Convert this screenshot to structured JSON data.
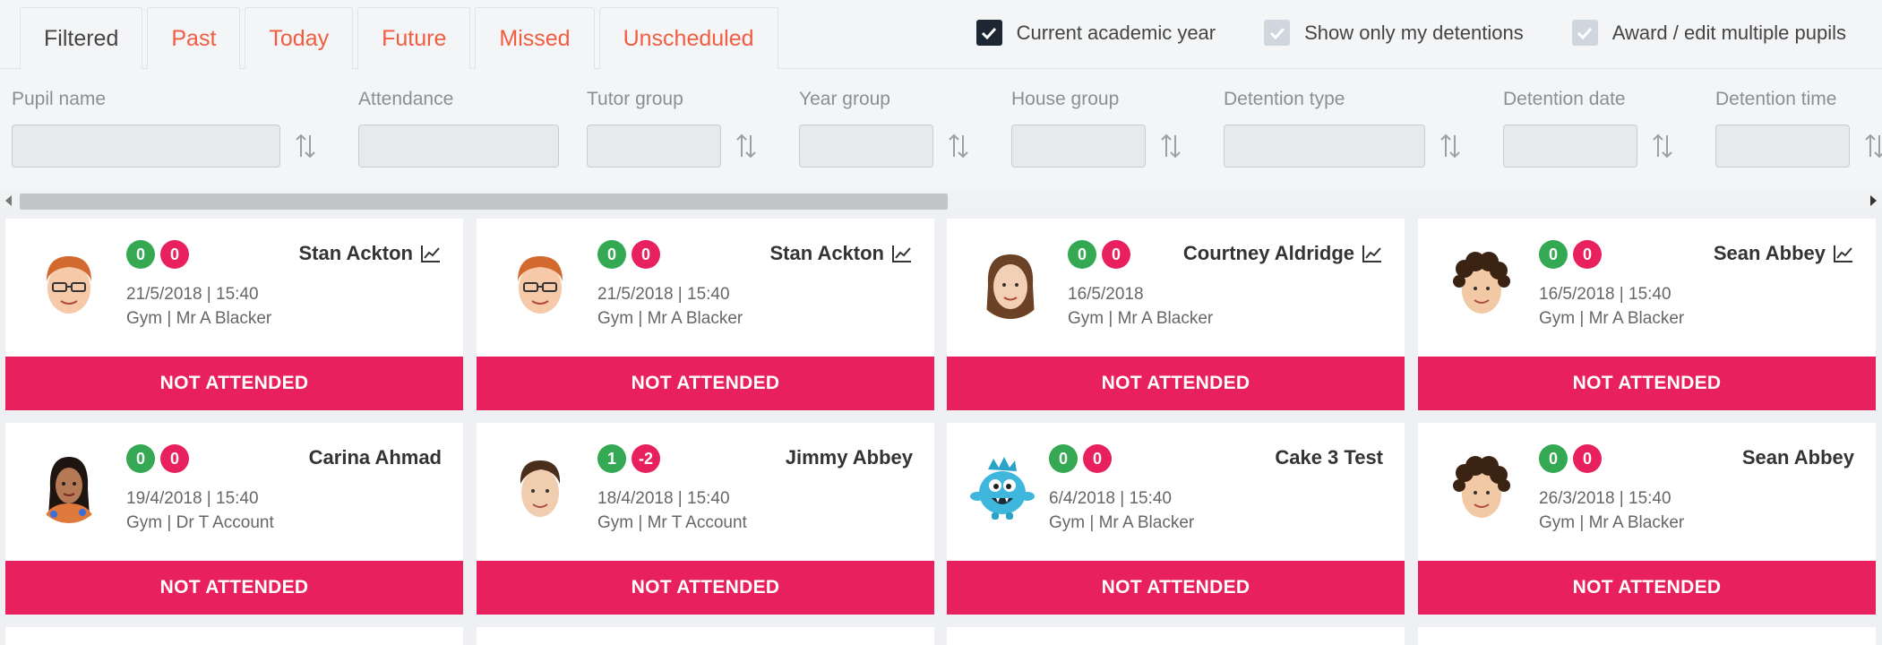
{
  "tabs": [
    {
      "label": "Filtered",
      "active": true
    },
    {
      "label": "Past",
      "active": false
    },
    {
      "label": "Today",
      "active": false
    },
    {
      "label": "Future",
      "active": false
    },
    {
      "label": "Missed",
      "active": false
    },
    {
      "label": "Unscheduled",
      "active": false
    }
  ],
  "options": [
    {
      "label": "Current academic year",
      "checked": true
    },
    {
      "label": "Show only my detentions",
      "checked": false
    },
    {
      "label": "Award / edit multiple pupils",
      "checked": false
    }
  ],
  "filters": [
    {
      "label": "Pupil name"
    },
    {
      "label": "Attendance"
    },
    {
      "label": "Tutor group"
    },
    {
      "label": "Year group"
    },
    {
      "label": "House group"
    },
    {
      "label": "Detention type"
    },
    {
      "label": "Detention date"
    },
    {
      "label": "Detention time"
    }
  ],
  "cards": [
    {
      "name": "Stan Ackton",
      "positive": "0",
      "negative": "0",
      "date": "21/5/2018 | 15:40",
      "place": "Gym | Mr A Blacker",
      "status": "NOT ATTENDED",
      "avatar": "redhead-boy-icon",
      "trend": true
    },
    {
      "name": "Stan Ackton",
      "positive": "0",
      "negative": "0",
      "date": "21/5/2018 | 15:40",
      "place": "Gym | Mr A Blacker",
      "status": "NOT ATTENDED",
      "avatar": "redhead-boy-icon",
      "trend": true
    },
    {
      "name": "Courtney Aldridge",
      "positive": "0",
      "negative": "0",
      "date": "16/5/2018",
      "place": "Gym | Mr A Blacker",
      "status": "NOT ATTENDED",
      "avatar": "girl-icon",
      "trend": true
    },
    {
      "name": "Sean Abbey",
      "positive": "0",
      "negative": "0",
      "date": "16/5/2018 | 15:40",
      "place": "Gym | Mr A Blacker",
      "status": "NOT ATTENDED",
      "avatar": "curly-boy-icon",
      "trend": true
    },
    {
      "name": "Carina Ahmad",
      "positive": "0",
      "negative": "0",
      "date": "19/4/2018 | 15:40",
      "place": "Gym | Dr T Account",
      "status": "NOT ATTENDED",
      "avatar": "woman-icon",
      "trend": false
    },
    {
      "name": "Jimmy Abbey",
      "positive": "1",
      "negative": "-2",
      "date": "18/4/2018 | 15:40",
      "place": "Gym | Mr T Account",
      "status": "NOT ATTENDED",
      "avatar": "boy-icon",
      "trend": false
    },
    {
      "name": "Cake 3 Test",
      "positive": "0",
      "negative": "0",
      "date": "6/4/2018 | 15:40",
      "place": "Gym | Mr A Blacker",
      "status": "NOT ATTENDED",
      "avatar": "monster-icon",
      "trend": false
    },
    {
      "name": "Sean Abbey",
      "positive": "0",
      "negative": "0",
      "date": "26/3/2018 | 15:40",
      "place": "Gym | Mr A Blacker",
      "status": "NOT ATTENDED",
      "avatar": "curly-boy-icon",
      "trend": false
    }
  ],
  "colors": {
    "accent": "#f25c3f",
    "status": "#e8205e",
    "positive": "#34a853",
    "negative": "#e8205e"
  }
}
